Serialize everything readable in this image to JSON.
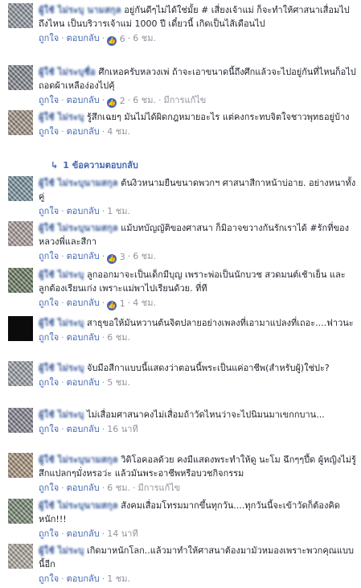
{
  "labels": {
    "like": "ถูกใจ",
    "reply": "ตอบกลับ",
    "edited": "มีการแก้ไข",
    "view_replies": "1 ข้อความตอบกลับ"
  },
  "comments": [
    {
      "author": "ผู้ใช้ ไม่ระบุ นามสกุล",
      "text": "อยู่กันดีๆไม่ได้ใช่มั้ย # เสี่ยงเจ้าแม่ ก็จะทำให้ศาสนาเสื่อมไปถึงไหน เป็นบริวารเจ้าแม่ 1000 ปี เดี๋ยวนี้ เกิดเป็นไส้เดือนไป",
      "reactions": "6",
      "time": "6 ชม.",
      "edited": false
    },
    {
      "author": "ผู้ใช้ ไม่ระบุชื่อ",
      "text": "ศึกเหอครับหลวงเพ่ ถ้าจะเอาขนาดนี้ถึงศึกแล้วจะไปอยู่กันที่ไหนก็อไป ถอดผ้าเหลือง่องไปคุ้",
      "reactions": "2",
      "time": "6 ชม.",
      "edited": true
    },
    {
      "author": "ผู้ใช้ ไม่ระบุ",
      "text": "รู้สึกเฉยๆ มันไม่ได้ผิดกฎหมายอะไร แต่คงกระทบจิตใจชาวพุทธอยู่บ้าง",
      "reactions": "",
      "time": "4 ชม.",
      "edited": false,
      "has_replies": true
    },
    {
      "author": "ผู้ใช้ ไม่ระบุนามสกุล",
      "text": "ต้นงิวหนามยืนขนาดพวกฯ ศาสนาสีกาหน้าบ่อาย. อย่างหนาทั้งคู่",
      "reactions": "",
      "time": "1 ชม.",
      "edited": false
    },
    {
      "author": "ผู้ใช้ ไม่ระบุนามสกุล",
      "text": "แม้บทบัญญัติของศาสนา ก็มิอาจขวางกันรักเราได้ #รักที่ของหลวงพี่และสีกา",
      "reactions": "3",
      "time": "6 ชม.",
      "edited": false
    },
    {
      "author": "ผู้ใช้ ไม่ระบุ",
      "text": "ลูกออกมาจะเป็นเด็กมีบุญ เพราะพ่อเป็นนักบวช สวดมนต์เช้าเย็น และลูกต้องเรียนเก่ง เพราะแม่พาไปเรียนด้วย. ที่ที",
      "reactions": "1",
      "time": "4 ชม.",
      "edited": false
    },
    {
      "author": "ผู้ใช้ ไม่ระบุ",
      "text": "สาธุขอให้มันหวานต้นจิตปลายอย่างเพลงที่เอามาแปลงที่เถอะ....ฟาวนะ",
      "reactions": "",
      "time": "6 ชม.",
      "edited": false
    },
    {
      "author": "ผู้ใช้ ไม่ระบุ",
      "text": "จับมือสีกาแบบนี้แสดงว่าตอนนี้พระเป็นแค่อาชีพ(สำหรับผู้)ใช่ปะ?",
      "reactions": "",
      "time": "5 ชม.",
      "edited": false
    },
    {
      "author": "ผู้ใช้ ไม่ระบุ",
      "text": "ไม่เสื่อมศาสนาคงไม่เสื่อมถ้าวัดไหนว่าจะไปนิมนมาเขกกบาน...",
      "reactions": "",
      "time": "16 นาที",
      "edited": false
    },
    {
      "author": "ผู้ใช้ ไม่ระบุนามสกุล",
      "text": "วิดิโอคอลด้วย คงมีแสดงพระทำให้ดู นะโม ฉึกๆๆปึ้ด ผู้หญิงไม่รู้สึกแปลกๆมั่งหรอว่ะ แล้วมันพระอาชีพหรือบวชกิจกรรม",
      "reactions": "",
      "time": "6 ชม.",
      "edited": true
    },
    {
      "author": "ผู้ใช้ ไม่ระบุนามสกุล",
      "text": "สังคมเสื่อมโทรมมากขึ้นทุกวัน....ทุกวันนี้จะเข้าวัดก็ต้องคิดหนัก!!!",
      "reactions": "",
      "time": "14 นาที",
      "edited": false
    },
    {
      "author": "ผู้ใช้ ไม่ระบุ",
      "text": "เกิดมาหนักโลก..แล้วมาทำให้ศาสนาต้องมามัวหมองเพราะพวกคุณแบบนี้อีก",
      "reactions": "",
      "time": "1 ชม.",
      "edited": false
    }
  ],
  "colors": {
    "link": "#365899",
    "action": "#4267b2",
    "meta": "#90949c",
    "text": "#1d2129"
  }
}
